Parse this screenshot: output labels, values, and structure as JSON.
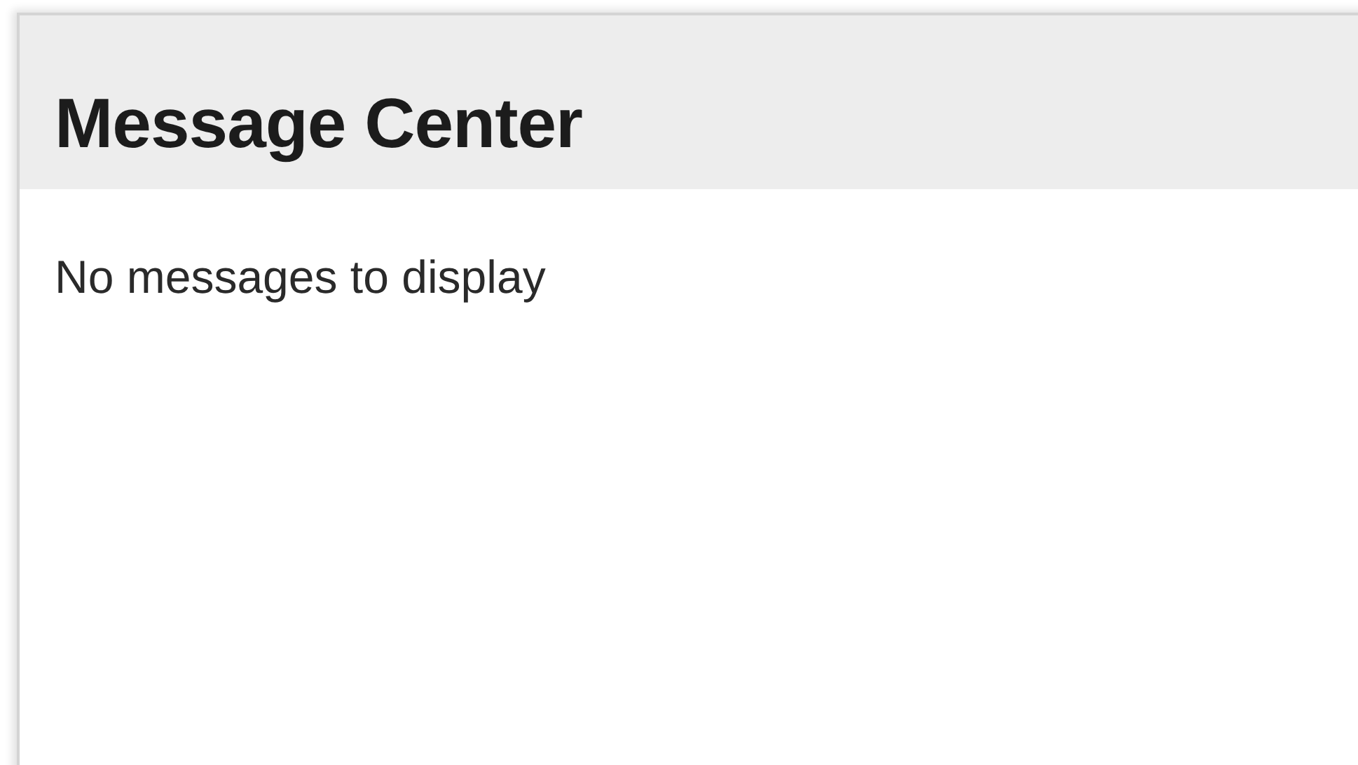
{
  "panel": {
    "title": "Message Center",
    "empty_text": "No messages to display"
  }
}
